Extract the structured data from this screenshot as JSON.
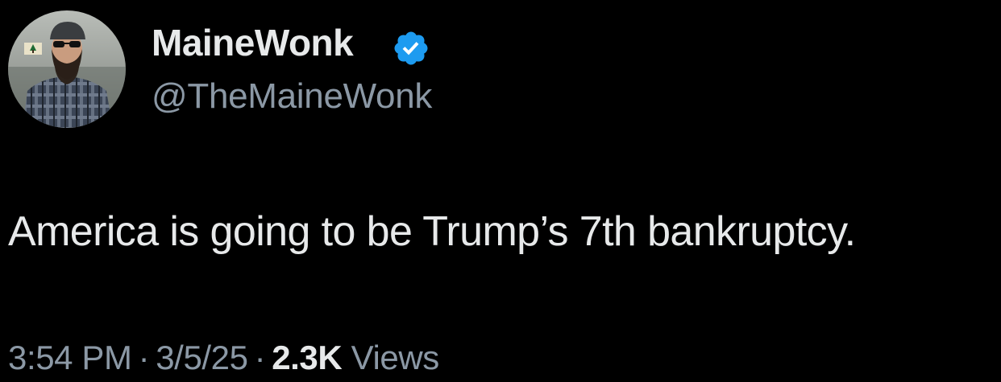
{
  "author": {
    "display_name": "MaineWonk",
    "handle": "@TheMaineWonk",
    "verified_icon": "verified-badge-icon",
    "verified_color": "#1d9bf0"
  },
  "tweet": {
    "text": "America is going to be Trump’s 7th bankruptcy."
  },
  "meta": {
    "time": "3:54 PM",
    "separator": "·",
    "date": "3/5/25",
    "views_count": "2.3K",
    "views_label": "Views"
  },
  "colors": {
    "background": "#000000",
    "primary_text": "#e7e9ea",
    "secondary_text": "#8b98a5"
  }
}
